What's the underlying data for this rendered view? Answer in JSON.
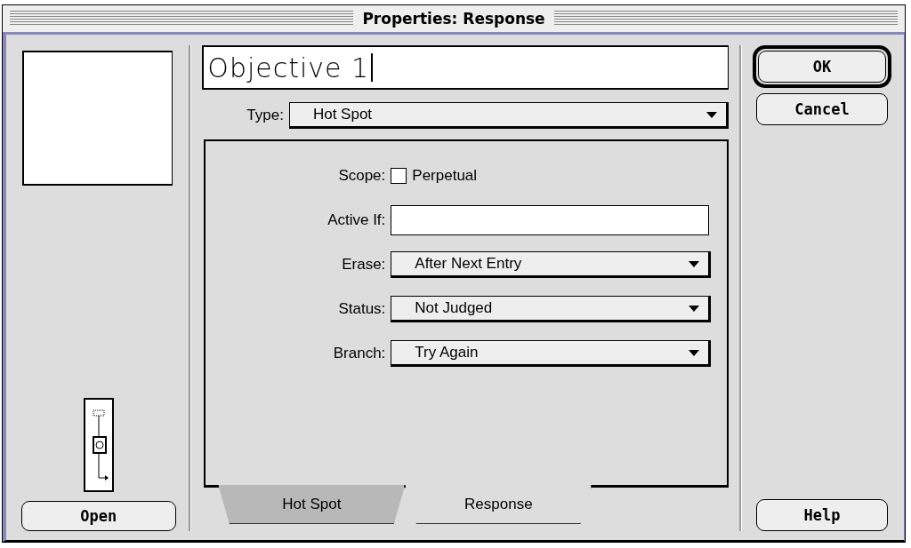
{
  "window": {
    "title": "Properties: Response"
  },
  "name_field": {
    "value": "Objective 1"
  },
  "type": {
    "label": "Type:",
    "value": "Hot Spot"
  },
  "fields": [
    {
      "kind": "checkbox",
      "label": "Scope:",
      "option": "Perpetual",
      "checked": false
    },
    {
      "kind": "text",
      "label": "Active If:"
    },
    {
      "kind": "dropdown",
      "label": "Erase:",
      "value": "After Next Entry"
    },
    {
      "kind": "dropdown",
      "label": "Status:",
      "value": "Not Judged"
    },
    {
      "kind": "dropdown",
      "label": "Branch:",
      "value": "Try Again"
    }
  ],
  "tabs": [
    {
      "label": "Hot Spot",
      "selected": false
    },
    {
      "label": "Response",
      "selected": true
    }
  ],
  "buttons": [
    {
      "label": "OK",
      "default": true
    },
    {
      "label": "Cancel",
      "default": false
    }
  ],
  "help_button": "Help",
  "open_button": "Open"
}
